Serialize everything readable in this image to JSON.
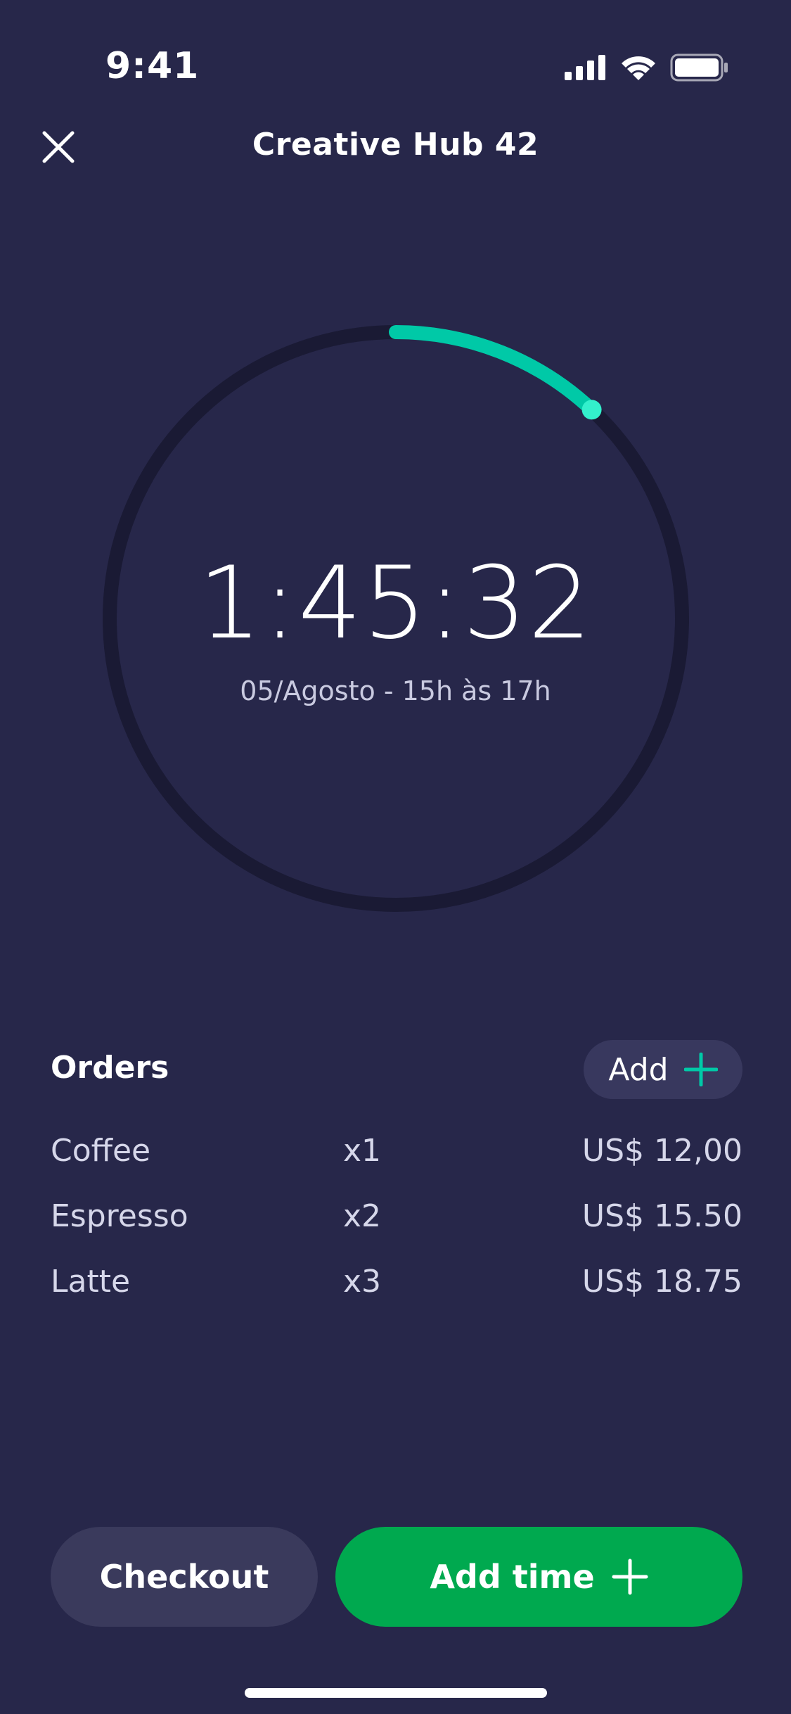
{
  "status_bar": {
    "time": "9:41"
  },
  "header": {
    "title": "Creative Hub 42",
    "close_icon": "close-icon"
  },
  "timer": {
    "elapsed": "1:45:32",
    "schedule": "05/Agosto - 15h às 17h",
    "progress_fraction": 0.12,
    "track_color": "#1a1a34",
    "progress_color": "#00c9a7"
  },
  "orders": {
    "title": "Orders",
    "add_label": "Add",
    "items": [
      {
        "name": "Coffee",
        "qty": "x1",
        "price": "US$ 12,00"
      },
      {
        "name": "Espresso",
        "qty": "x2",
        "price": "US$ 15.50"
      },
      {
        "name": "Latte",
        "qty": "x3",
        "price": "US$ 18.75"
      }
    ]
  },
  "actions": {
    "checkout_label": "Checkout",
    "add_time_label": "Add time"
  },
  "colors": {
    "background": "#27274a",
    "accent": "#00c9a7",
    "primary_button": "#00a94f",
    "secondary_button": "#3a3a5c"
  }
}
